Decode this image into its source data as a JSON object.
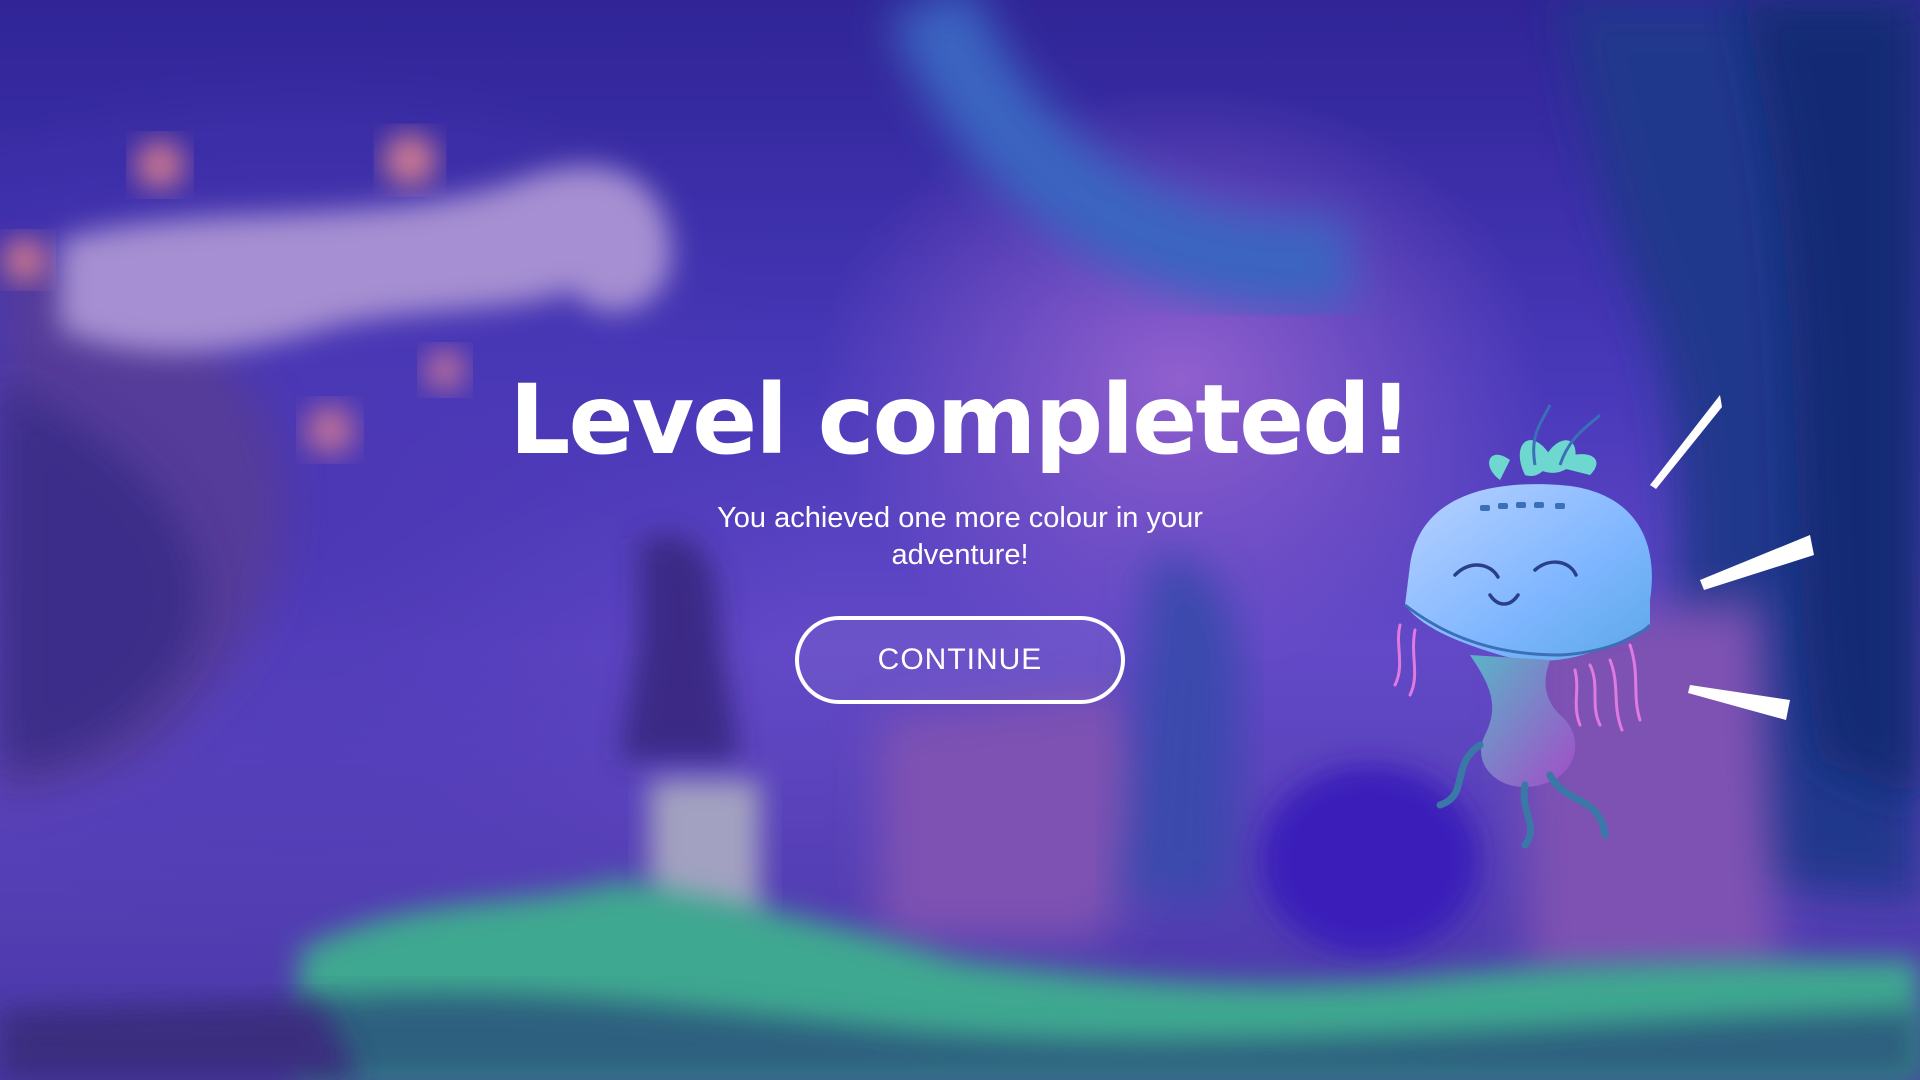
{
  "screen": {
    "title": "Level completed!",
    "subtitle": "You achieved one more colour in your adventure!",
    "continue_label": "CONTINUE"
  },
  "colors": {
    "background_primary": "#4a3cbf",
    "background_glow": "#a06ad8",
    "text": "#ffffff",
    "mascot_head": "#7fb6ff",
    "mascot_tentacles": "#e07ae0",
    "ground": "#3fbf8f"
  },
  "icons": {
    "mascot": "jellyfish-mascot",
    "burst": "celebration-burst-lines"
  }
}
